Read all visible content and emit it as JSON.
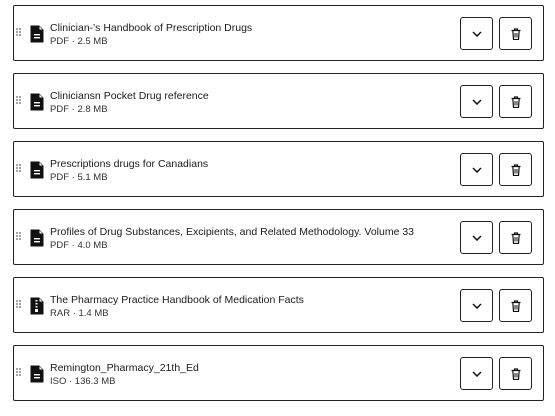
{
  "files": [
    {
      "title": "Clinician-'s Handbook of Prescription Drugs",
      "meta": "PDF · 2.5 MB",
      "icon": "document-icon"
    },
    {
      "title": "Cliniciansn Pocket Drug reference",
      "meta": "PDF · 2.8 MB",
      "icon": "document-icon"
    },
    {
      "title": "Prescriptions drugs for Canadians",
      "meta": "PDF · 5.1 MB",
      "icon": "document-icon"
    },
    {
      "title": "Profiles of Drug Substances, Excipients, and Related Methodology. Volume 33",
      "meta": "PDF · 4.0 MB",
      "icon": "document-icon"
    },
    {
      "title": "The Pharmacy Practice Handbook of Medication Facts",
      "meta": "RAR · 1.4 MB",
      "icon": "archive-icon"
    },
    {
      "title": "Remington_Pharmacy_21th_Ed",
      "meta": "ISO · 136.3 MB",
      "icon": "document-icon"
    }
  ],
  "icons": {
    "drag": "drag-handle-icon",
    "expand": "chevron-down-icon",
    "delete": "trash-icon"
  },
  "colors": {
    "border": "#222222",
    "text": "#1b1b1b",
    "icon": "#111111"
  }
}
